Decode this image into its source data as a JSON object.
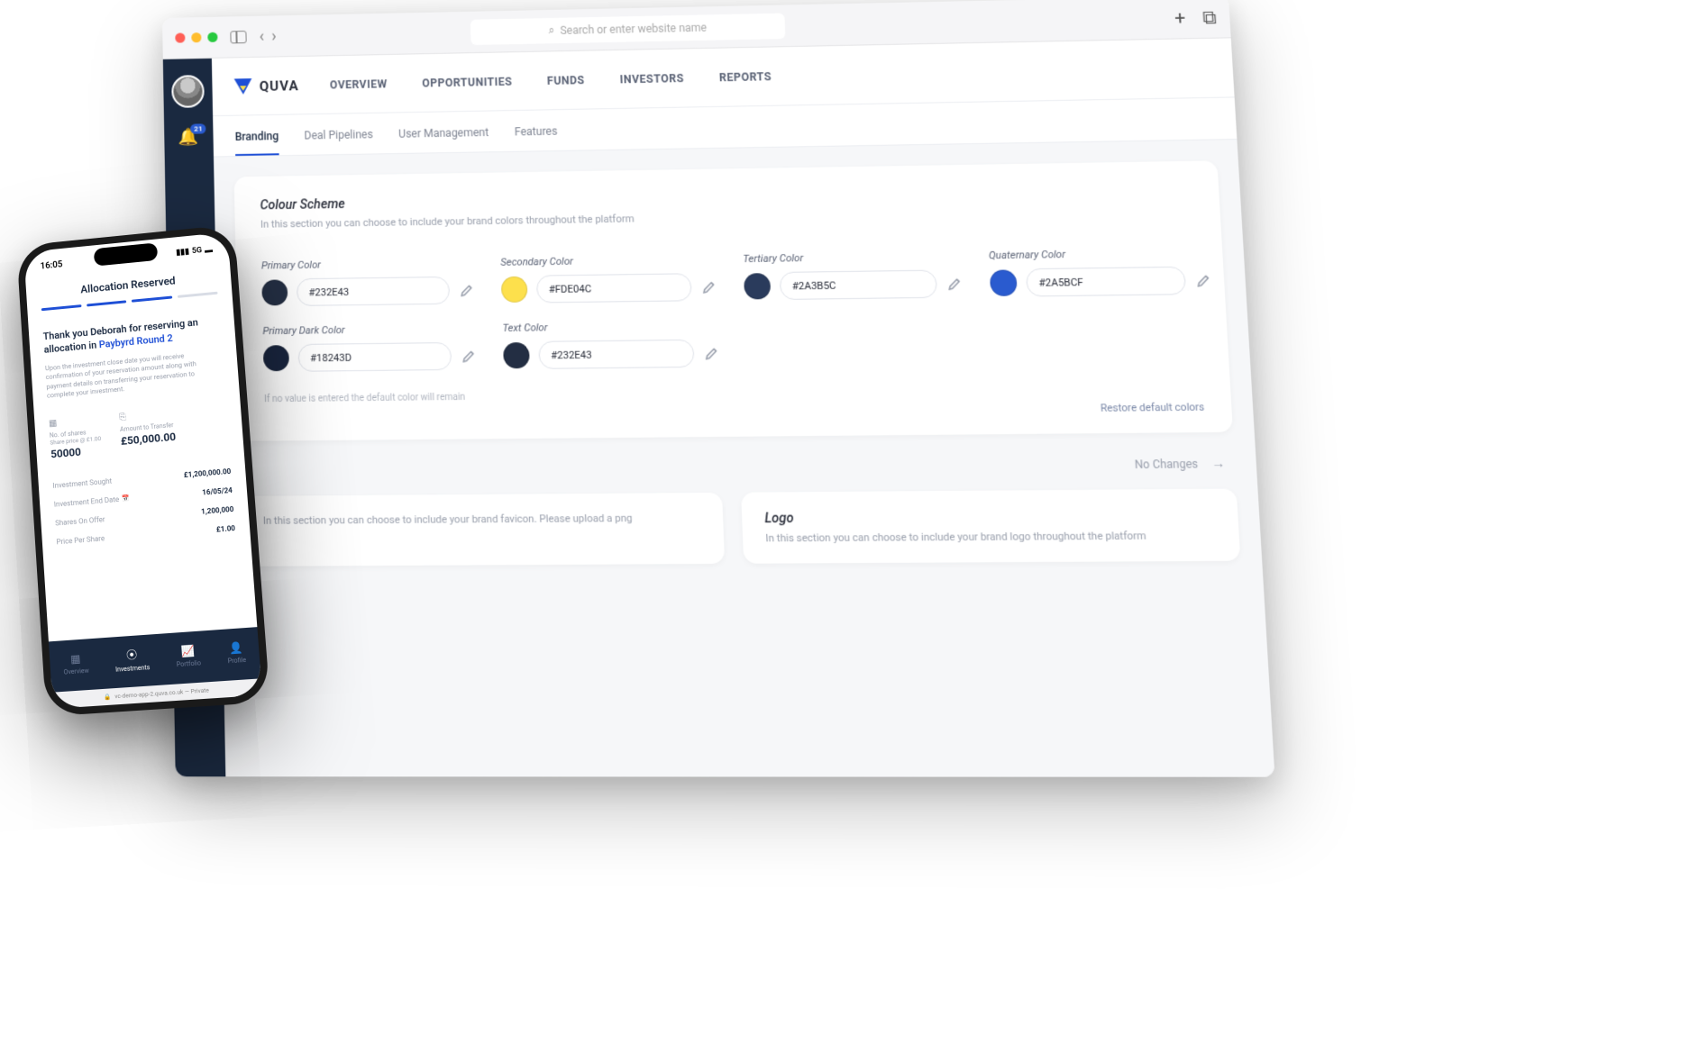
{
  "browser": {
    "url_placeholder": "Search or enter website name"
  },
  "rail": {
    "notif_count": "21"
  },
  "logo_text": "QUVA",
  "nav": {
    "items": [
      "OVERVIEW",
      "OPPORTUNITIES",
      "FUNDS",
      "INVESTORS",
      "REPORTS"
    ]
  },
  "subtabs": [
    "Branding",
    "Deal Pipelines",
    "User Management",
    "Features"
  ],
  "colour_scheme": {
    "title": "Colour Scheme",
    "desc": "In this section you can choose to include your brand colors throughout the platform",
    "footnote": "If no value is entered the default color will remain",
    "restore_label": "Restore default colors",
    "fields": [
      {
        "label": "Primary Color",
        "value": "#232E43",
        "swatch": "#232E43"
      },
      {
        "label": "Secondary Color",
        "value": "#FDE04C",
        "swatch": "#FDE04C"
      },
      {
        "label": "Tertiary Color",
        "value": "#2A3B5C",
        "swatch": "#2A3B5C"
      },
      {
        "label": "Quaternary Color",
        "value": "#2A5BCF",
        "swatch": "#2A5BCF"
      },
      {
        "label": "Primary Dark Color",
        "value": "#18243D",
        "swatch": "#18243D"
      },
      {
        "label": "Text Color",
        "value": "#232E43",
        "swatch": "#232E43"
      }
    ]
  },
  "no_changes_label": "No Changes",
  "favicon_section": {
    "desc": "In this section you can choose to include your brand favicon. Please upload a png"
  },
  "logo_section": {
    "title": "Logo",
    "desc": "In this section you can choose to include your brand logo throughout the platform"
  },
  "phone": {
    "time": "16:05",
    "signal_label": "5G",
    "page_title": "Allocation Reserved",
    "thank_prefix": "Thank you Deborah for reserving an allocation in ",
    "thank_link": "Paybyrd Round 2",
    "detail_text": "Upon the investment close date you will receive confirmation of your reservation amount along with payment details on transferring your reservation to complete your investment.",
    "stat1": {
      "label": "No. of shares",
      "sub": "Share price @ £1.00",
      "value": "50000"
    },
    "stat2": {
      "label": "Amount to Transfer",
      "value": "£50,000.00"
    },
    "rows": [
      {
        "label": "Investment Sought",
        "value": "£1,200,000.00"
      },
      {
        "label": "Investment End Date",
        "value": "16/05/24",
        "has_cal": true
      },
      {
        "label": "Shares On Offer",
        "value": "1,200,000"
      },
      {
        "label": "Price Per Share",
        "value": "£1.00"
      }
    ],
    "tabs": [
      "Overview",
      "Investments",
      "Portfolio",
      "Profile"
    ],
    "url_strip": "vc-demo-app-2.quva.co.uk — Private"
  }
}
